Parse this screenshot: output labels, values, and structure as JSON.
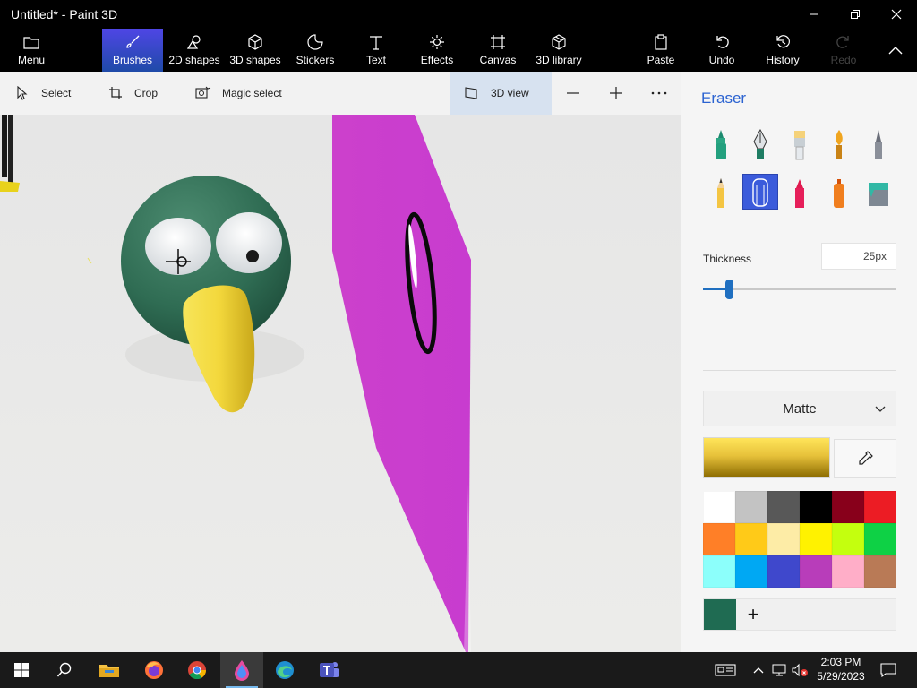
{
  "window": {
    "title": "Untitled* - Paint 3D"
  },
  "ribbon": {
    "items": [
      {
        "label": "Menu",
        "icon": "folder-icon"
      },
      {
        "label": "Brushes",
        "icon": "brush-icon",
        "active": true
      },
      {
        "label": "2D shapes",
        "icon": "2d-shapes-icon"
      },
      {
        "label": "3D shapes",
        "icon": "3d-shapes-icon"
      },
      {
        "label": "Stickers",
        "icon": "stickers-icon"
      },
      {
        "label": "Text",
        "icon": "text-icon"
      },
      {
        "label": "Effects",
        "icon": "effects-icon"
      },
      {
        "label": "Canvas",
        "icon": "canvas-icon"
      },
      {
        "label": "3D library",
        "icon": "3d-library-icon"
      },
      {
        "label": "Paste",
        "icon": "paste-icon"
      },
      {
        "label": "Undo",
        "icon": "undo-icon"
      },
      {
        "label": "History",
        "icon": "history-icon"
      },
      {
        "label": "Redo",
        "icon": "redo-icon",
        "disabled": true
      }
    ]
  },
  "toolbar": {
    "select": "Select",
    "crop": "Crop",
    "magic_select": "Magic select",
    "view3d": "3D view"
  },
  "panel": {
    "title": "Eraser",
    "brushes": [
      "marker",
      "calligraphy-pen",
      "oil-brush",
      "watercolor",
      "pixel-pen",
      "pencil",
      "eraser",
      "crayon",
      "spray-can",
      "fill"
    ],
    "selected_brush": "eraser",
    "thickness_label": "Thickness",
    "thickness_value": "25px",
    "thickness_fraction": 0.13,
    "finish": "Matte",
    "current_color": "#f6cf38",
    "palette": [
      "#ffffff",
      "#c3c3c3",
      "#585858",
      "#000000",
      "#88001b",
      "#ec1c24",
      "#ff7f27",
      "#ffca18",
      "#fdeca6",
      "#fff200",
      "#c4ff0e",
      "#0ed145",
      "#8cfffb",
      "#00a8f3",
      "#3f48cc",
      "#b83dba",
      "#ffaec8",
      "#b97a56"
    ],
    "custom_color": "#1f6b52",
    "add_color": "+"
  },
  "taskbar": {
    "apps": [
      "windows-start",
      "search",
      "file-explorer",
      "firefox",
      "chrome",
      "paint-3d",
      "edge",
      "teams"
    ],
    "time": "2:03 PM",
    "date": "5/29/2023"
  }
}
